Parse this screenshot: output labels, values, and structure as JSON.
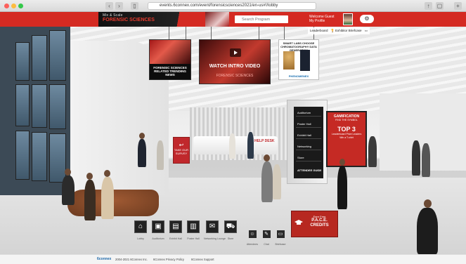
{
  "browser": {
    "url": "events.6connex.com/event/forensicsciences2021/en-us#!/lobby"
  },
  "header": {
    "logo_line1": "Mix & Scale",
    "logo_line2": "FORENSIC SCIENCES",
    "search_placeholder": "Search Program",
    "welcome_line1": "Welcome Guest",
    "welcome_line2": "My Profile",
    "leaderboard": "Leaderboard",
    "briefcase": "Exhibitor Briefcase"
  },
  "screens": {
    "left_caption": "FORENSIC SCIENCES RELATED TRENDING NEWS",
    "video_caption": "WATCH INTRO VIDEO",
    "video_sub": "FORENSIC SCIENCES",
    "ad_title": "SMART LABS CHOOSE CHROMATOGRAPHY DATA GENERATION",
    "ad_brand": "PHENOMENEX"
  },
  "kiosk": {
    "items": [
      "Auditorium",
      "Poster Hall",
      "Exhibit Hall",
      "Networking",
      "Store"
    ],
    "footer": "ATTENDEE GUIDE"
  },
  "gamification": {
    "title": "GAMIFICATION",
    "subtitle": "FIND THE SYMBOL",
    "top": "TOP 3",
    "body": "Leaderboard Prize Leaders Win a T-shirt"
  },
  "left_kiosk": "TAKE OUR SURVEY",
  "help_desk": "HELP DESK",
  "nav": [
    {
      "label": "Lobby",
      "icon": "home-icon",
      "glyph": "⌂"
    },
    {
      "label": "Auditorium",
      "icon": "presentation-icon",
      "glyph": "▣"
    },
    {
      "label": "Exhibit Hall",
      "icon": "booth-icon",
      "glyph": "▤"
    },
    {
      "label": "Poster Hall",
      "icon": "poster-icon",
      "glyph": "▥"
    },
    {
      "label": "Networking Lounge",
      "icon": "chat-icon",
      "glyph": "✉"
    },
    {
      "label": "Store",
      "icon": "cart-icon",
      "glyph": "⛟"
    }
  ],
  "utility": [
    {
      "label": "Attendees",
      "icon": "people-icon",
      "glyph": "☺"
    },
    {
      "label": "Chat",
      "icon": "chat-bubble-icon",
      "glyph": "✎"
    },
    {
      "label": "Briefcase",
      "icon": "briefcase-icon",
      "glyph": "▭"
    }
  ],
  "pace": {
    "line1": "Earn Free",
    "line2": "P.A.C.E.",
    "line3": "CREDITS"
  },
  "footer": {
    "brand": "6connex",
    "copyright": "2004-2021 6Connex Inc.",
    "privacy": "6Connex Privacy Policy",
    "support": "6Connex Support"
  },
  "colors": {
    "brand_red": "#d42a22",
    "dark": "#1a1a1a"
  }
}
